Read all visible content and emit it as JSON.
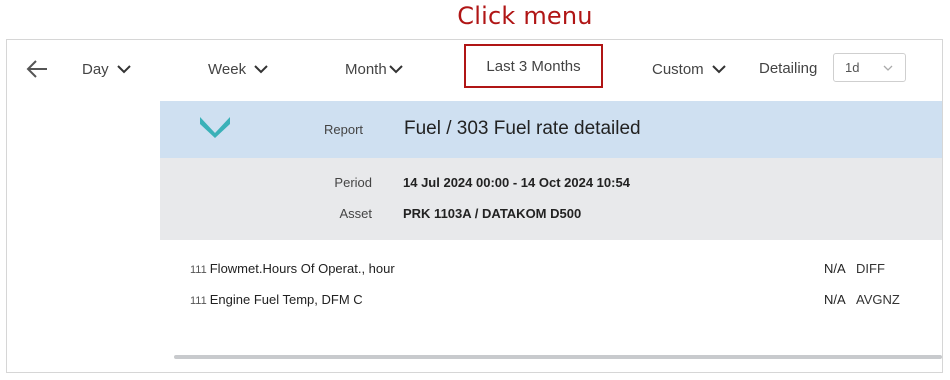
{
  "annotation": "Click menu",
  "toolbar": {
    "day": "Day",
    "week": "Week",
    "month": "Month",
    "last3": "Last 3 Months",
    "custom": "Custom",
    "detailing_label": "Detailing",
    "detailing_value": "1d"
  },
  "report": {
    "label": "Report",
    "title": "Fuel / 303 Fuel rate detailed",
    "period_label": "Period",
    "period_value": "14 Jul 2024 00:00 - 14 Oct 2024 10:54",
    "asset_label": "Asset",
    "asset_value": "PRK 1103A / DATAKOM D500",
    "rows": [
      {
        "num": "111",
        "name": "Flowmet.Hours Of Operat., hour",
        "value": "N/A",
        "fn": "DIFF"
      },
      {
        "num": "111",
        "name": "Engine Fuel Temp, DFM C",
        "value": "N/A",
        "fn": "AVGNZ"
      }
    ]
  },
  "colors": {
    "accent_icon": "#3ab1b8",
    "highlight_border": "#b01515",
    "header_bg": "#cfe0f1",
    "meta_bg": "#e8e9eb"
  }
}
